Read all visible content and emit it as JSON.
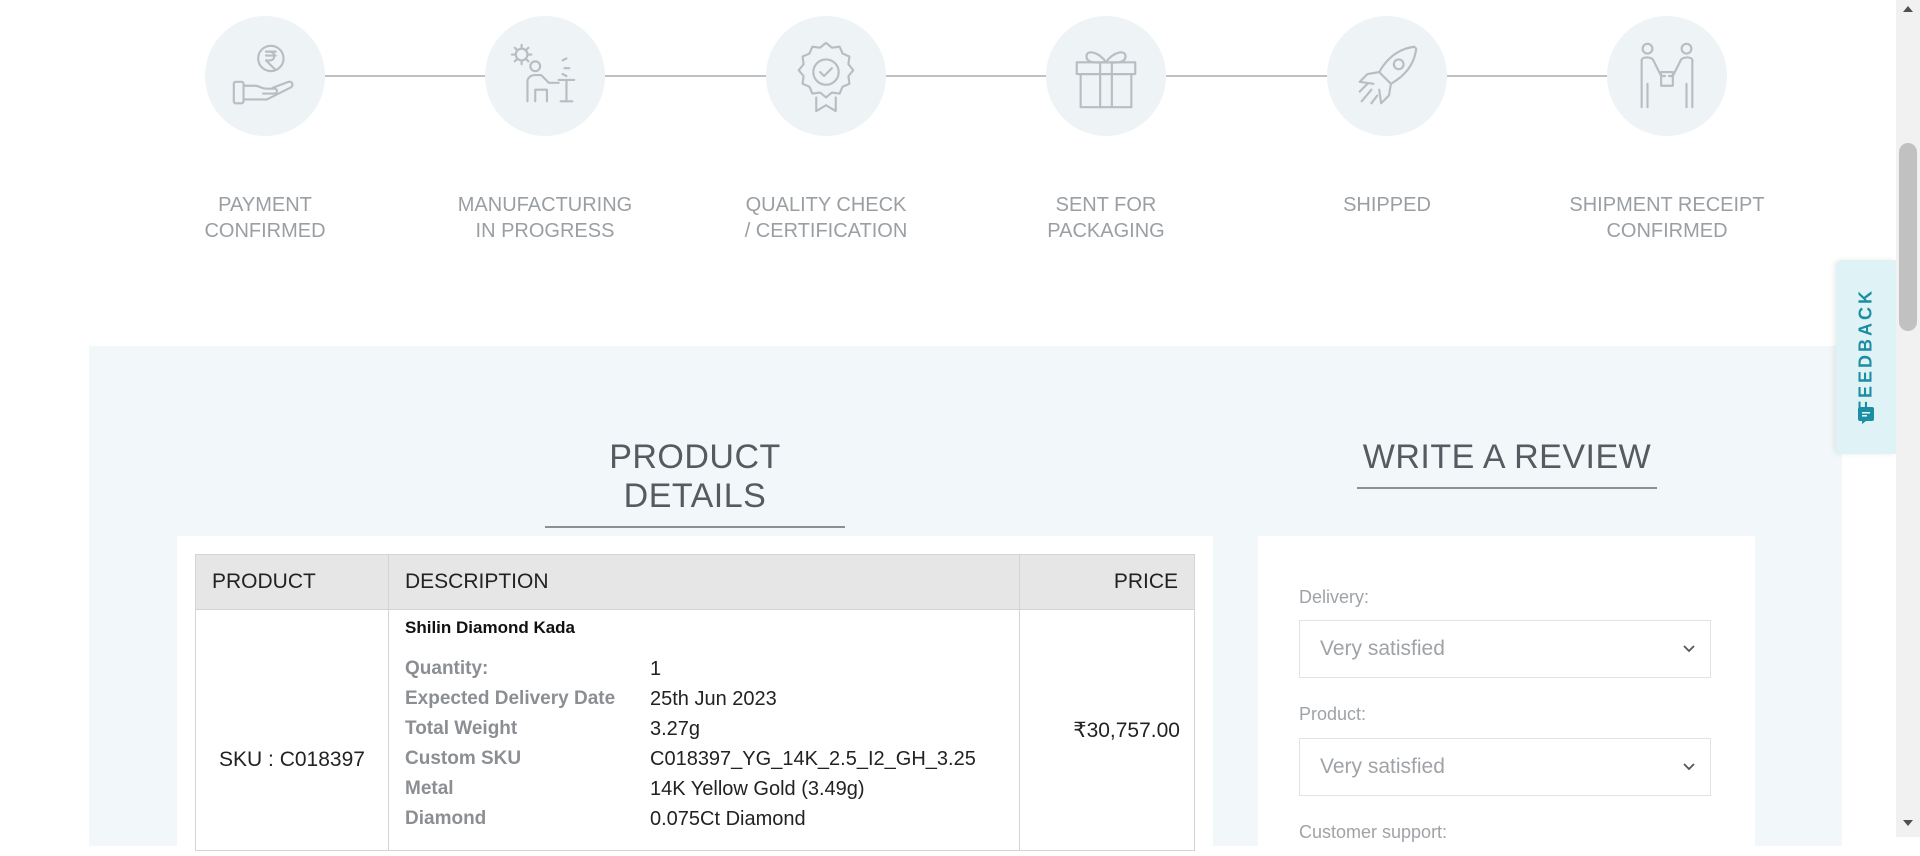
{
  "tracker": {
    "steps": [
      {
        "label": "PAYMENT\nCONFIRMED",
        "icon": "payment-hand-rupee-icon"
      },
      {
        "label": "MANUFACTURING\nIN PROGRESS",
        "icon": "manufacturing-worker-icon"
      },
      {
        "label": "QUALITY CHECK\n/ CERTIFICATION",
        "icon": "certificate-badge-icon"
      },
      {
        "label": "SENT FOR\nPACKAGING",
        "icon": "gift-box-icon"
      },
      {
        "label": "SHIPPED",
        "icon": "rocket-icon"
      },
      {
        "label": "SHIPMENT RECEIPT\nCONFIRMED",
        "icon": "handover-people-icon"
      }
    ]
  },
  "product_details": {
    "title": "PRODUCT DETAILS",
    "table": {
      "headers": {
        "product": "PRODUCT",
        "description": "DESCRIPTION",
        "price": "PRICE"
      },
      "rows": [
        {
          "sku": "SKU : C018397",
          "name": "Shilin Diamond Kada",
          "price": "₹30,757.00",
          "attributes": [
            {
              "key": "Quantity:",
              "value": "1"
            },
            {
              "key": "Expected Delivery Date",
              "value": "25th Jun 2023"
            },
            {
              "key": "Total Weight",
              "value": "3.27g"
            },
            {
              "key": "Custom SKU",
              "value": "C018397_YG_14K_2.5_I2_GH_3.25"
            },
            {
              "key": "Metal",
              "value": "14K Yellow Gold (3.49g)"
            },
            {
              "key": "Diamond",
              "value": "0.075Ct Diamond"
            }
          ]
        }
      ]
    }
  },
  "review": {
    "title": "WRITE A REVIEW",
    "fields": [
      {
        "label": "Delivery:",
        "value": "Very satisfied"
      },
      {
        "label": "Product:",
        "value": "Very satisfied"
      },
      {
        "label": "Customer support:"
      }
    ]
  },
  "feedback_tab": {
    "label": "FEEDBACK",
    "icon": "feedback-comment-icon"
  },
  "colors": {
    "accent": "#1b8ea3",
    "panel_bg": "#f2f7f9",
    "step_circle": "#eef3f6",
    "muted_text": "#9a9fa4"
  }
}
